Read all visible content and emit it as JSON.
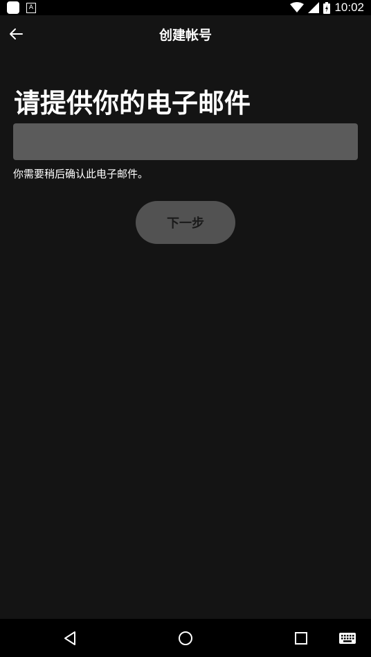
{
  "status_bar": {
    "time": "10:02",
    "icons": [
      "app-icon",
      "a-notification-icon",
      "wifi-icon",
      "cell-signal-icon",
      "battery-icon"
    ]
  },
  "header": {
    "title": "创建帐号",
    "back_icon": "arrow-left-icon"
  },
  "main": {
    "heading": "请提供你的电子邮件",
    "email_input": {
      "value": "",
      "placeholder": ""
    },
    "hint": "你需要稍后确认此电子邮件。",
    "next_label": "下一步"
  },
  "nav_bar": {
    "icons": [
      "back-triangle-icon",
      "home-circle-icon",
      "recents-square-icon",
      "keyboard-icon"
    ]
  },
  "colors": {
    "background": "#141414",
    "input_bg": "#5b5b5b",
    "button_bg": "#525252",
    "text": "#ffffff"
  }
}
